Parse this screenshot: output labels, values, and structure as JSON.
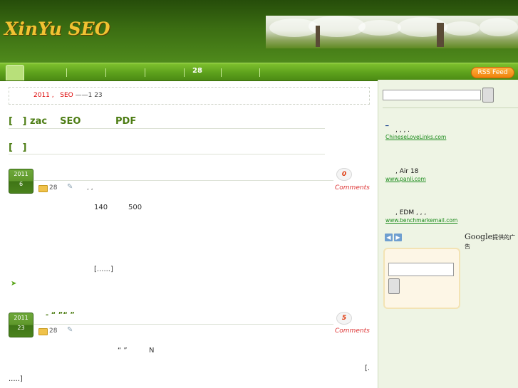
{
  "site": {
    "logo_text": "XinYu SEO"
  },
  "nav": {
    "item_28": "28",
    "rss_label": "RSS Feed"
  },
  "info": {
    "year": "2011",
    "sep": ",",
    "seo": "SEO",
    "suffix": "——1 23"
  },
  "titles": {
    "t1": {
      "bracket": "[",
      "close": "]",
      "w1": "zac",
      "w2": "SEO",
      "w3": "PDF"
    },
    "t2": {
      "bracket": "[",
      "close": "]"
    }
  },
  "posts": [
    {
      "badge_year": "2011",
      "badge_day": "6",
      "comments_count": "0",
      "comments_label": "Comments",
      "category": "28",
      "tags": ",     ,",
      "text_a": "140",
      "text_b": "500",
      "more": "[......]"
    },
    {
      "badge_year": "2011",
      "badge_day": "23",
      "title": "-     “        ”“        ”",
      "comments_count": "5",
      "comments_label": "Comments",
      "category": "28",
      "text_a": "“  ”",
      "text_b": "N",
      "more_end": "[.",
      "more_tail": ".....]"
    }
  ],
  "sidebar": {
    "ads": [
      {
        "title": "_",
        "text": ",          ,          ,         .",
        "url": "ChineseLoveLinks.com"
      },
      {
        "title": "           ",
        "text": ",                      Air    18",
        "url": "www.panli.com"
      },
      {
        "title": "       ",
        "text": ", EDM     ,        ,        ,",
        "url": "www.benchmarkemail.com"
      }
    ],
    "google_label": "Google",
    "google_suffix": "提供的广告"
  },
  "icons": [
    "home-tab",
    "folder-icon",
    "tag-icon",
    "arrow-icon",
    "prev-arrow-icon",
    "next-arrow-icon"
  ],
  "colors": {
    "header_green": "#3b6d12",
    "nav_green": "#5da11c",
    "title_green": "#4d7d14",
    "logo_gold": "#f1c232",
    "rss_orange": "#f0820c"
  }
}
